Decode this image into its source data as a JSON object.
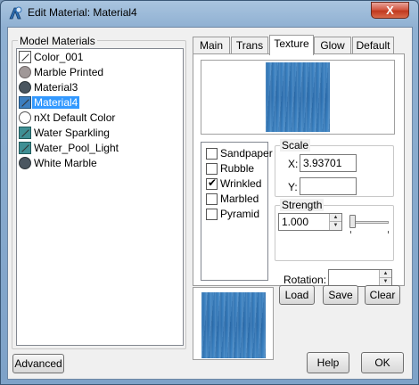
{
  "window": {
    "title": "Edit Material: Material4",
    "close_glyph": "X"
  },
  "materials": {
    "group_label": "Model Materials",
    "items": [
      {
        "label": "Color_001",
        "icon": "square-white-diag",
        "selected": false
      },
      {
        "label": "Marble Printed",
        "icon": "circle-gray",
        "selected": false
      },
      {
        "label": "Material3",
        "icon": "circle-dark",
        "selected": false
      },
      {
        "label": "Material4",
        "icon": "square-blue-diag",
        "selected": true
      },
      {
        "label": "nXt Default Color",
        "icon": "circle-white",
        "selected": false
      },
      {
        "label": "Water Sparkling",
        "icon": "square-teal-diag",
        "selected": false
      },
      {
        "label": "Water_Pool_Light",
        "icon": "square-teal-diag",
        "selected": false
      },
      {
        "label": "White Marble",
        "icon": "circle-dark",
        "selected": false
      }
    ]
  },
  "tabs": [
    {
      "label": "Main",
      "active": false
    },
    {
      "label": "Trans",
      "active": false
    },
    {
      "label": "Texture",
      "active": true
    },
    {
      "label": "Glow",
      "active": false
    },
    {
      "label": "Default",
      "active": false
    }
  ],
  "texture": {
    "effects": [
      {
        "label": "Sandpaper",
        "checked": false
      },
      {
        "label": "Rubble",
        "checked": false
      },
      {
        "label": "Wrinkled",
        "checked": true
      },
      {
        "label": "Marbled",
        "checked": false
      },
      {
        "label": "Pyramid",
        "checked": false
      }
    ],
    "scale": {
      "group_label": "Scale",
      "x_label": "X:",
      "x_value": "3.93701",
      "y_label": "Y:",
      "y_value": ""
    },
    "strength": {
      "group_label": "Strength",
      "value": "1.000",
      "slider_level": 0.05
    },
    "rotation": {
      "label": "Rotation:",
      "value": ""
    }
  },
  "buttons": {
    "load": "Load",
    "save": "Save",
    "clear": "Clear",
    "advanced": "Advanced",
    "help": "Help",
    "ok": "OK"
  },
  "colors": {
    "title_gradient_top": "#a9c4df",
    "selection": "#3399ff",
    "texture_blue": "#3b83c4"
  }
}
